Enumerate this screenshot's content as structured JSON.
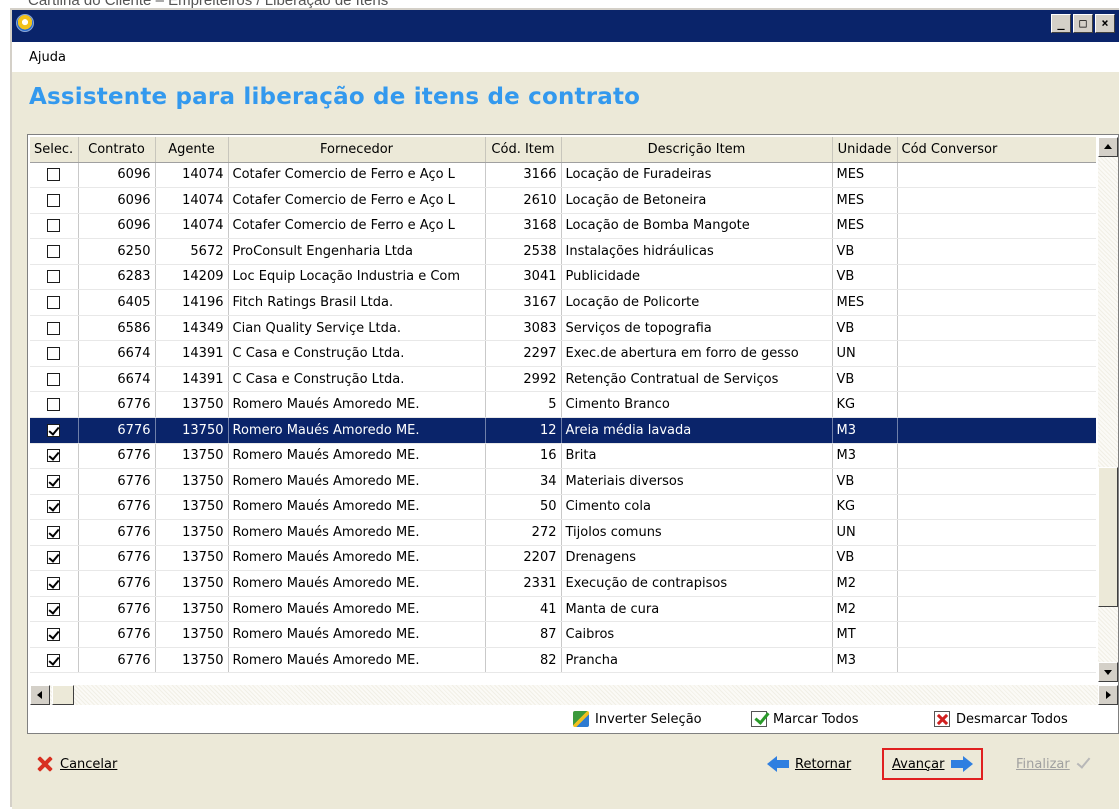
{
  "caption": "Cartilha do Cliente – Empreiteiros / Liberação de Itens",
  "window": {
    "controls": [
      "_",
      "□",
      "×"
    ]
  },
  "menu": {
    "items": [
      "Ajuda"
    ]
  },
  "heading": "Assistente para liberação de itens de contrato",
  "table": {
    "columns": [
      "Selec.",
      "Contrato",
      "Agente",
      "Fornecedor",
      "Cód. Item",
      "Descrição Item",
      "Unidade",
      "Cód Conversor"
    ],
    "rows": [
      {
        "checked": false,
        "contrato": "6096",
        "agente": "14074",
        "fornecedor": "Cotafer Comercio de Ferro e Aço L",
        "cod_item": "3166",
        "descricao": "Locação de Furadeiras",
        "unidade": "MES",
        "conversor": ""
      },
      {
        "checked": false,
        "contrato": "6096",
        "agente": "14074",
        "fornecedor": "Cotafer Comercio de Ferro e Aço L",
        "cod_item": "2610",
        "descricao": "Locação de Betoneira",
        "unidade": "MES",
        "conversor": ""
      },
      {
        "checked": false,
        "contrato": "6096",
        "agente": "14074",
        "fornecedor": "Cotafer Comercio de Ferro e Aço L",
        "cod_item": "3168",
        "descricao": "Locação de Bomba Mangote",
        "unidade": "MES",
        "conversor": ""
      },
      {
        "checked": false,
        "contrato": "6250",
        "agente": "5672",
        "fornecedor": "ProConsult Engenharia Ltda",
        "cod_item": "2538",
        "descricao": "Instalações hidráulicas",
        "unidade": "VB",
        "conversor": ""
      },
      {
        "checked": false,
        "contrato": "6283",
        "agente": "14209",
        "fornecedor": "Loc Equip Locação Industria e Com",
        "cod_item": "3041",
        "descricao": "Publicidade",
        "unidade": "VB",
        "conversor": ""
      },
      {
        "checked": false,
        "contrato": "6405",
        "agente": "14196",
        "fornecedor": "Fitch Ratings Brasil Ltda.",
        "cod_item": "3167",
        "descricao": "Locação de Policorte",
        "unidade": "MES",
        "conversor": ""
      },
      {
        "checked": false,
        "contrato": "6586",
        "agente": "14349",
        "fornecedor": "Cian Quality Serviçe Ltda.",
        "cod_item": "3083",
        "descricao": "Serviços de topografia",
        "unidade": "VB",
        "conversor": ""
      },
      {
        "checked": false,
        "contrato": "6674",
        "agente": "14391",
        "fornecedor": "C Casa e Construção Ltda.",
        "cod_item": "2297",
        "descricao": "Exec.de abertura em forro de gesso",
        "unidade": "UN",
        "conversor": ""
      },
      {
        "checked": false,
        "contrato": "6674",
        "agente": "14391",
        "fornecedor": "C Casa e Construção Ltda.",
        "cod_item": "2992",
        "descricao": "Retenção Contratual de Serviços",
        "unidade": "VB",
        "conversor": ""
      },
      {
        "checked": false,
        "contrato": "6776",
        "agente": "13750",
        "fornecedor": "Romero Maués Amoredo ME.",
        "cod_item": "5",
        "descricao": "Cimento Branco",
        "unidade": "KG",
        "conversor": ""
      },
      {
        "checked": true,
        "selected": true,
        "contrato": "6776",
        "agente": "13750",
        "fornecedor": "Romero Maués Amoredo ME.",
        "cod_item": "12",
        "descricao": "Areia média lavada",
        "unidade": "M3",
        "conversor": ""
      },
      {
        "checked": true,
        "contrato": "6776",
        "agente": "13750",
        "fornecedor": "Romero Maués Amoredo ME.",
        "cod_item": "16",
        "descricao": "Brita",
        "unidade": "M3",
        "conversor": ""
      },
      {
        "checked": true,
        "contrato": "6776",
        "agente": "13750",
        "fornecedor": "Romero Maués Amoredo ME.",
        "cod_item": "34",
        "descricao": "Materiais diversos",
        "unidade": "VB",
        "conversor": ""
      },
      {
        "checked": true,
        "contrato": "6776",
        "agente": "13750",
        "fornecedor": "Romero Maués Amoredo ME.",
        "cod_item": "50",
        "descricao": "Cimento cola",
        "unidade": "KG",
        "conversor": ""
      },
      {
        "checked": true,
        "contrato": "6776",
        "agente": "13750",
        "fornecedor": "Romero Maués Amoredo ME.",
        "cod_item": "272",
        "descricao": "Tijolos comuns",
        "unidade": "UN",
        "conversor": ""
      },
      {
        "checked": true,
        "contrato": "6776",
        "agente": "13750",
        "fornecedor": "Romero Maués Amoredo ME.",
        "cod_item": "2207",
        "descricao": "Drenagens",
        "unidade": "VB",
        "conversor": ""
      },
      {
        "checked": true,
        "contrato": "6776",
        "agente": "13750",
        "fornecedor": "Romero Maués Amoredo ME.",
        "cod_item": "2331",
        "descricao": "Execução de contrapisos",
        "unidade": "M2",
        "conversor": ""
      },
      {
        "checked": true,
        "contrato": "6776",
        "agente": "13750",
        "fornecedor": "Romero Maués Amoredo ME.",
        "cod_item": "41",
        "descricao": "Manta de cura",
        "unidade": "M2",
        "conversor": ""
      },
      {
        "checked": true,
        "contrato": "6776",
        "agente": "13750",
        "fornecedor": "Romero Maués Amoredo ME.",
        "cod_item": "87",
        "descricao": "Caibros",
        "unidade": "MT",
        "conversor": ""
      },
      {
        "checked": true,
        "contrato": "6776",
        "agente": "13750",
        "fornecedor": "Romero Maués Amoredo ME.",
        "cod_item": "82",
        "descricao": "Prancha",
        "unidade": "M3",
        "conversor": ""
      }
    ]
  },
  "actions": {
    "invert": "Inverter Seleção",
    "mark_all": "Marcar Todos",
    "unmark_all": "Desmarcar Todos"
  },
  "footer": {
    "cancel": "Cancelar",
    "back": "Retornar",
    "next": "Avançar",
    "finish": "Finalizar"
  },
  "colors": {
    "heading": "#3399ee",
    "selection": "#0a246a",
    "titlebar": "#0a246a",
    "highlight_border": "#e02020"
  }
}
